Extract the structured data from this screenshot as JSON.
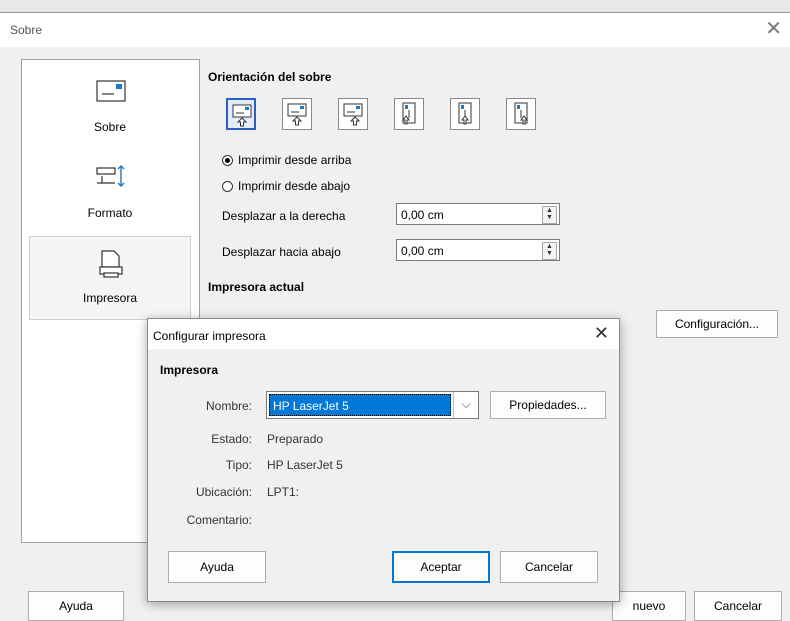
{
  "window": {
    "title": "Sobre"
  },
  "sidebar": {
    "items": [
      {
        "label": "Sobre",
        "icon": "envelope-icon"
      },
      {
        "label": "Formato",
        "icon": "format-icon"
      },
      {
        "label": "Impresora",
        "icon": "printer-icon"
      }
    ]
  },
  "orientation": {
    "heading": "Orientación del sobre",
    "buttons": [
      "horizontal-left",
      "horizontal-center",
      "horizontal-right",
      "vertical-left",
      "vertical-center",
      "vertical-right"
    ],
    "radio_top": "Imprimir desde arriba",
    "radio_bottom": "Imprimir desde abajo",
    "shift_right_label": "Desplazar a la derecha",
    "shift_right_value": "0,00 cm",
    "shift_down_label": "Desplazar hacia abajo",
    "shift_down_value": "0,00 cm"
  },
  "current_printer": {
    "heading": "Impresora actual",
    "config_button": "Configuración..."
  },
  "footer": {
    "help": "Ayuda",
    "new": "nuevo",
    "cancel": "Cancelar"
  },
  "dialog": {
    "title": "Configurar impresora",
    "section": "Impresora",
    "name_label": "Nombre:",
    "name_value": "HP LaserJet 5",
    "properties_button": "Propiedades...",
    "status_label": "Estado:",
    "status_value": "Preparado",
    "type_label": "Tipo:",
    "type_value": "HP LaserJet 5",
    "location_label": "Ubicación:",
    "location_value": "LPT1:",
    "comment_label": "Comentario:",
    "help": "Ayuda",
    "accept": "Aceptar",
    "cancel": "Cancelar"
  },
  "colors": {
    "accent": "#0078d7",
    "focus_border": "#2a5fbf"
  }
}
